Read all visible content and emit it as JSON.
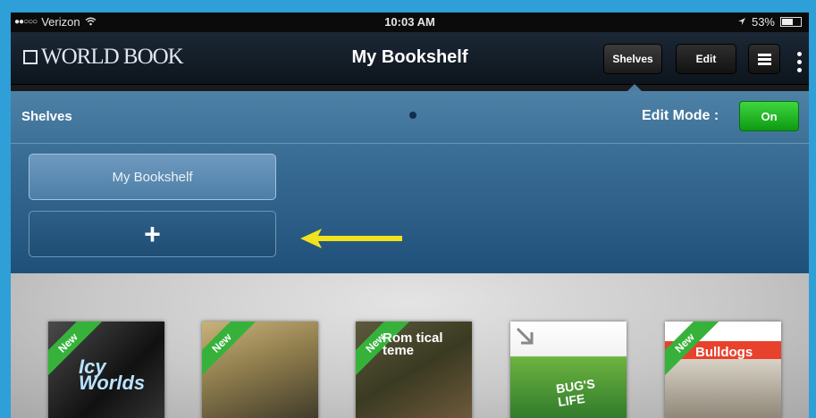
{
  "status_bar": {
    "carrier": "Verizon",
    "time": "10:03 AM",
    "battery": "53%",
    "battery_level": 0.53
  },
  "nav_bar": {
    "logo_text": "WORLD BOOK",
    "title": "My Bookshelf",
    "shelves_label": "Shelves",
    "edit_label": "Edit"
  },
  "shelves_panel": {
    "title": "Shelves",
    "edit_mode_label": "Edit Mode :",
    "edit_mode_toggle": "On",
    "shelf_items": [
      "My Bookshelf"
    ],
    "add_label": "+"
  },
  "books": [
    {
      "badge": "New",
      "cover_text": "Icy Worlds"
    },
    {
      "badge": "New",
      "cover_text": ""
    },
    {
      "badge": "New",
      "cover_text": "Rom tical teme"
    },
    {
      "badge": "",
      "cover_text": "BUG'S LIFE"
    },
    {
      "badge": "New",
      "cover_text": "Bulldogs"
    }
  ],
  "colors": {
    "frame": "#2f9fd8",
    "toggle_on": "#22b526",
    "arrow": "#f0e21c",
    "badge": "#36b23b"
  }
}
